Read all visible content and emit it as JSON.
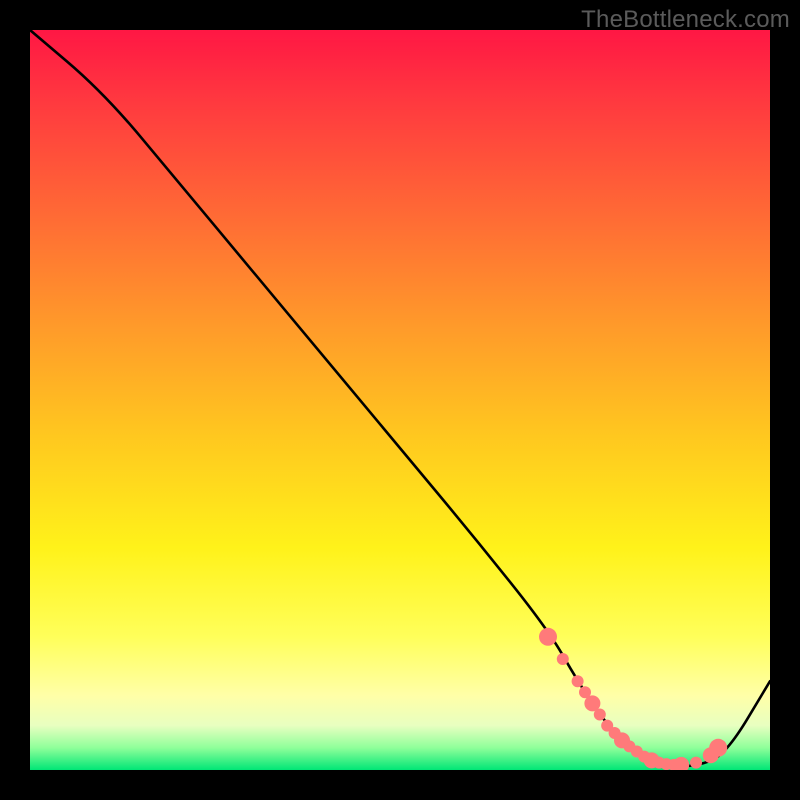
{
  "watermark": "TheBottleneck.com",
  "chart_data": {
    "type": "line",
    "title": "",
    "xlabel": "",
    "ylabel": "",
    "xlim": [
      0,
      100
    ],
    "ylim": [
      0,
      100
    ],
    "grid": false,
    "legend": false,
    "colors": {
      "top": "#ff1744",
      "mid": "#fff21a",
      "bottom": "#00e676",
      "line": "#000000",
      "dots": "#ff7a7a"
    },
    "series": [
      {
        "name": "curve",
        "x": [
          0,
          10,
          20,
          30,
          40,
          50,
          60,
          70,
          74,
          78,
          82,
          86,
          90,
          94,
          100
        ],
        "y": [
          100,
          91.5,
          79.5,
          67.5,
          55.5,
          43.5,
          31.5,
          19,
          12,
          6,
          2,
          0.5,
          0.5,
          2,
          12
        ]
      }
    ],
    "dots": {
      "x": [
        70,
        72,
        74,
        75,
        76,
        77,
        78,
        79,
        80,
        81,
        82,
        83,
        84,
        85,
        86,
        87,
        88,
        90,
        92,
        93
      ],
      "y": [
        18,
        15,
        12,
        10.5,
        9,
        7.5,
        6,
        5,
        4,
        3.2,
        2.5,
        1.8,
        1.3,
        1,
        0.8,
        0.7,
        0.7,
        1,
        2,
        3
      ],
      "r": [
        9,
        6,
        6,
        6,
        8,
        6,
        6,
        6,
        8,
        6,
        6,
        6,
        8,
        6,
        6,
        6,
        8,
        6,
        8,
        9
      ]
    }
  }
}
